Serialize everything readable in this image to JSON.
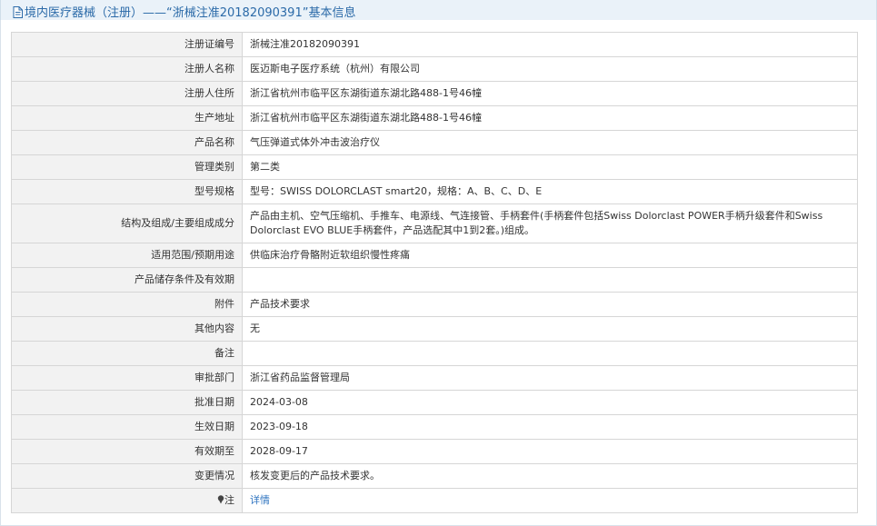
{
  "header": {
    "title": "境内医疗器械（注册）——“浙械注准20182090391”基本信息"
  },
  "rows": [
    {
      "label": "注册证编号",
      "value": "浙械注准20182090391"
    },
    {
      "label": "注册人名称",
      "value": "医迈斯电子医疗系统（杭州）有限公司"
    },
    {
      "label": "注册人住所",
      "value": "浙江省杭州市临平区东湖街道东湖北路488-1号46幢"
    },
    {
      "label": "生产地址",
      "value": "浙江省杭州市临平区东湖街道东湖北路488-1号46幢"
    },
    {
      "label": "产品名称",
      "value": "气压弹道式体外冲击波治疗仪"
    },
    {
      "label": "管理类别",
      "value": "第二类"
    },
    {
      "label": "型号规格",
      "value": "型号：SWISS DOLORCLAST smart20，规格：A、B、C、D、E"
    },
    {
      "label": "结构及组成/主要组成成分",
      "value": "产品由主机、空气压缩机、手推车、电源线、气连接管、手柄套件(手柄套件包括Swiss Dolorclast POWER手柄升级套件和Swiss Dolorclast EVO BLUE手柄套件，产品选配其中1到2套。)组成。"
    },
    {
      "label": "适用范围/预期用途",
      "value": "供临床治疗骨骼附近软组织慢性疼痛"
    },
    {
      "label": "产品储存条件及有效期",
      "value": ""
    },
    {
      "label": "附件",
      "value": "产品技术要求"
    },
    {
      "label": "其他内容",
      "value": "无"
    },
    {
      "label": "备注",
      "value": ""
    },
    {
      "label": "审批部门",
      "value": "浙江省药品监督管理局"
    },
    {
      "label": "批准日期",
      "value": "2024-03-08"
    },
    {
      "label": "生效日期",
      "value": "2023-09-18"
    },
    {
      "label": "有效期至",
      "value": "2028-09-17"
    },
    {
      "label": "变更情况",
      "value": "核发变更后的产品技术要求。"
    },
    {
      "label": "注",
      "value": "详情"
    }
  ],
  "colors": {
    "title": "#2b6aa8",
    "link": "#2f74c0",
    "label_bg": "#f2f2f2",
    "header_bg": "#eaf2f9"
  },
  "icons": {
    "title_icon": "document-icon",
    "note_icon": "pin-icon"
  }
}
